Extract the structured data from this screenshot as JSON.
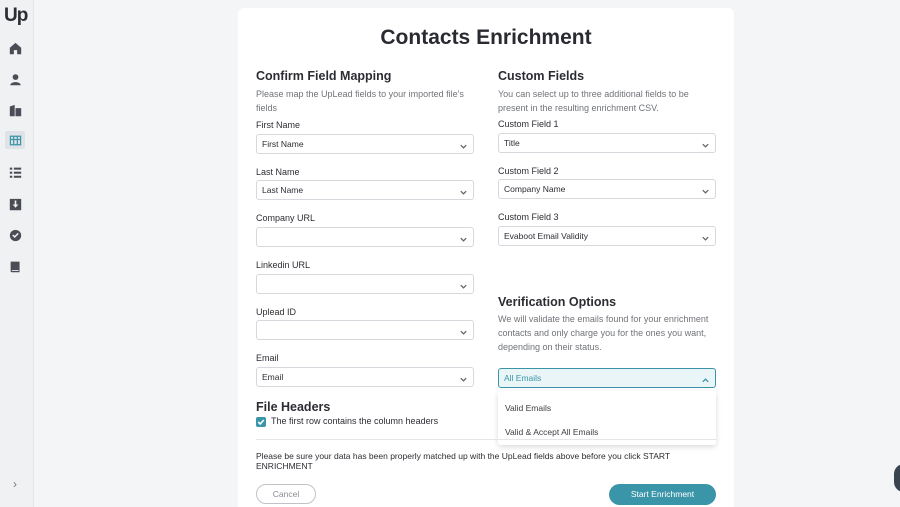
{
  "app": {
    "logo": "Up"
  },
  "sidebar": {
    "icons": [
      "home-icon",
      "user-icon",
      "building-icon",
      "table-icon",
      "list-icon",
      "download-icon",
      "check-circle-icon",
      "book-icon"
    ],
    "expand_glyph": "›"
  },
  "page": {
    "title": "Contacts Enrichment"
  },
  "mapping": {
    "title": "Confirm Field Mapping",
    "description": "Please map the UpLead fields to your imported file's fields",
    "fields": [
      {
        "label": "First Name",
        "value": "First Name"
      },
      {
        "label": "Last Name",
        "value": "Last Name"
      },
      {
        "label": "Company URL",
        "value": ""
      },
      {
        "label": "Linkedin URL",
        "value": ""
      },
      {
        "label": "Uplead ID",
        "value": ""
      },
      {
        "label": "Email",
        "value": "Email"
      }
    ]
  },
  "custom": {
    "title": "Custom Fields",
    "description": "You can select up to three additional fields to be present in the resulting enrichment CSV.",
    "fields": [
      {
        "label": "Custom Field 1",
        "value": "Title"
      },
      {
        "label": "Custom Field 2",
        "value": "Company Name"
      },
      {
        "label": "Custom Field 3",
        "value": "Evaboot Email Validity"
      }
    ]
  },
  "verification": {
    "title": "Verification Options",
    "description": "We will validate the emails found for your enrichment contacts and only charge you for the ones you want, depending on their status.",
    "selected": "All Emails",
    "options": [
      "Valid Emails",
      "Valid & Accept All Emails"
    ]
  },
  "headers": {
    "title": "File Headers",
    "checkbox_label": "The first row contains the column headers",
    "checked": true
  },
  "notice": "Please be sure your data has been properly matched up with the UpLead fields above before you click START ENRICHMENT",
  "buttons": {
    "cancel": "Cancel",
    "start": "Start Enrichment"
  },
  "colors": {
    "accent": "#3a95a8",
    "background": "#f4f5f7"
  }
}
